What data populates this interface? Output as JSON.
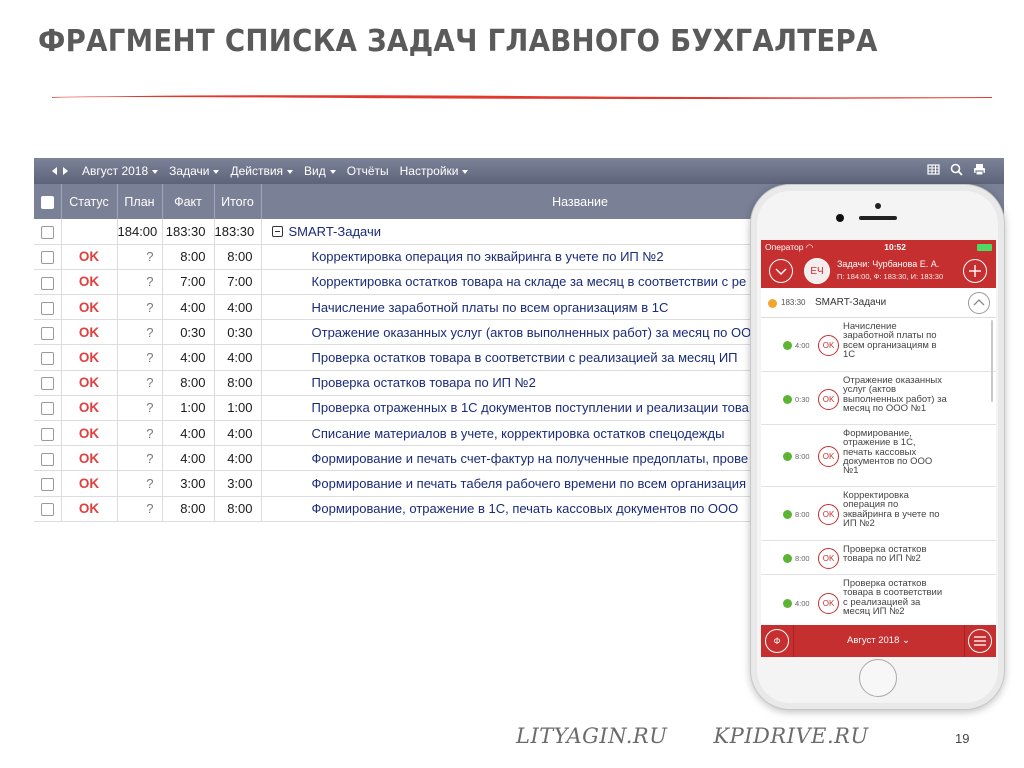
{
  "slide": {
    "title": "ФРАГМЕНТ СПИСКА  ЗАДАЧ ГЛАВНОГО БУХГАЛТЕРА",
    "accent_color": "#e03a2f",
    "footer_links": [
      "LITYAGIN.RU",
      "KPIDRIVE.RU"
    ],
    "page_number": "19"
  },
  "app": {
    "toolbar": {
      "period": "Август 2018",
      "menu": [
        "Задачи",
        "Действия",
        "Вид",
        "Отчёты",
        "Настройки"
      ],
      "icons": [
        "grid-icon",
        "search-icon",
        "print-icon"
      ]
    },
    "table": {
      "headers": {
        "status": "Статус",
        "plan": "План",
        "fact": "Факт",
        "total": "Итого",
        "name": "Название"
      },
      "group": {
        "plan": "184:00",
        "fact": "183:30",
        "total": "183:30",
        "name": "SMART-Задачи"
      },
      "rows": [
        {
          "status": "OK",
          "plan": "?",
          "fact": "8:00",
          "total": "8:00",
          "name": "Корректировка операция по эквайринга в учете по ИП №2"
        },
        {
          "status": "OK",
          "plan": "?",
          "fact": "7:00",
          "total": "7:00",
          "name": "Корректировка остатков товара на складе за месяц в соответствии с ре"
        },
        {
          "status": "OK",
          "plan": "?",
          "fact": "4:00",
          "total": "4:00",
          "name": "Начисление заработной платы по всем организациям в 1С"
        },
        {
          "status": "OK",
          "plan": "?",
          "fact": "0:30",
          "total": "0:30",
          "name": "Отражение оказанных услуг (актов выполненных работ) за месяц по ОО"
        },
        {
          "status": "OK",
          "plan": "?",
          "fact": "4:00",
          "total": "4:00",
          "name": "Проверка остатков товара в соответствии с реализацией за месяц ИП"
        },
        {
          "status": "OK",
          "plan": "?",
          "fact": "8:00",
          "total": "8:00",
          "name": "Проверка остатков товара по ИП №2"
        },
        {
          "status": "OK",
          "plan": "?",
          "fact": "1:00",
          "total": "1:00",
          "name": "Проверка отраженных в 1С документов поступлении и реализации това"
        },
        {
          "status": "OK",
          "plan": "?",
          "fact": "4:00",
          "total": "4:00",
          "name": "Списание материалов в учете, корректировка остатков спецодежды"
        },
        {
          "status": "OK",
          "plan": "?",
          "fact": "4:00",
          "total": "4:00",
          "name": "Формирование и печать счет-фактур на полученные предоплаты, прове"
        },
        {
          "status": "OK",
          "plan": "?",
          "fact": "3:00",
          "total": "3:00",
          "name": "Формирование и печать табеля рабочего времени по всем организация"
        },
        {
          "status": "OK",
          "plan": "?",
          "fact": "8:00",
          "total": "8:00",
          "name": "Формирование, отражение в 1С, печать кассовых документов по ООО"
        }
      ]
    }
  },
  "phone": {
    "status_bar": {
      "carrier": "Оператор",
      "time": "10:52"
    },
    "header": {
      "avatar": "ЕЧ",
      "title": "Задачи: Чурбанова Е. А.",
      "subtitle": "П: 184:00, Ф: 183:30, И: 183:30"
    },
    "group": {
      "time": "183:30",
      "label": "SMART-Задачи"
    },
    "items": [
      {
        "time": "4:00",
        "ok": "OK",
        "text": "Начисление\nзаработной платы по\nвсем организациям в\n1С"
      },
      {
        "time": "0:30",
        "ok": "OK",
        "text": "Отражение оказанных\nуслуг (актов\nвыполненных работ) за\nмесяц по ООО №1"
      },
      {
        "time": "8:00",
        "ok": "OK",
        "text": "Формирование,\nотражение в 1С,\nпечать кассовых\nдокументов по ООО\n№1"
      },
      {
        "time": "8:00",
        "ok": "OK",
        "text": "Корректировка\nоперация по\nэквайринга в учете по\nИП №2"
      },
      {
        "time": "8:00",
        "ok": "OK",
        "text": "Проверка остатков\nтовара по ИП №2"
      },
      {
        "time": "4:00",
        "ok": "OK",
        "text": "Проверка остатков\nтовара в соответствии\nс реализацией за\nмесяц ИП №2"
      }
    ],
    "footer": {
      "left_icon": "Ф",
      "month": "Август 2018"
    }
  }
}
